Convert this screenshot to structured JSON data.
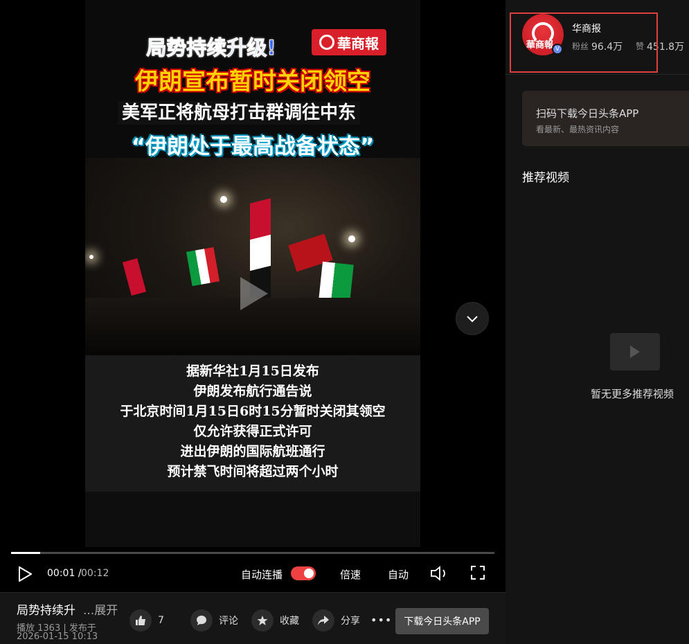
{
  "video": {
    "headline_1": "局势持续升级!",
    "logo_text": "華商報",
    "headline_2": "伊朗宣布暂时关闭领空",
    "headline_3": "美军正将航母打击群调往中东",
    "headline_4": "“伊朗处于最高战备状态”",
    "captions": [
      "据新华社1月15日发布",
      "伊朗发布航行通告说",
      "于北京时间1月15日6时15分暂时关闭其领空",
      "仅允许获得正式许可",
      "进出伊朗的国际航班通行",
      "预计禁飞时间将超过两个小时"
    ]
  },
  "player": {
    "progress": 0.06,
    "time_current": "00:01",
    "time_separator": "/",
    "time_total": "00:12",
    "autoplay_label": "自动连播",
    "autoplay_on": true,
    "speed_label": "倍速",
    "quality_label": "自动"
  },
  "info": {
    "title": "局势持续升",
    "expand": "...展开",
    "plays_label": "播放 1363 | 发布于",
    "publish_time": "2026-01-15 10:13",
    "like_count": "7",
    "comment_label": "评论",
    "collect_label": "收藏",
    "share_label": "分享",
    "more_label": "•••",
    "download_label": "下载今日头条APP"
  },
  "sidebar": {
    "author": {
      "avatar_text": "華商報",
      "verified": "V",
      "name": "华商报",
      "fans_label": "粉丝",
      "fans_count": "96.4万",
      "likes_label": "赞",
      "likes_count": "451.8万"
    },
    "app_card": {
      "title": "扫码下载今日头条APP",
      "subtitle": "看最新、最热资讯内容"
    },
    "recommended_title": "推荐视频",
    "empty_text": "暂无更多推荐视频"
  },
  "colors": {
    "accent_red": "#f04142",
    "highlight_box": "#e0403d",
    "logo_red": "#d9202a"
  }
}
